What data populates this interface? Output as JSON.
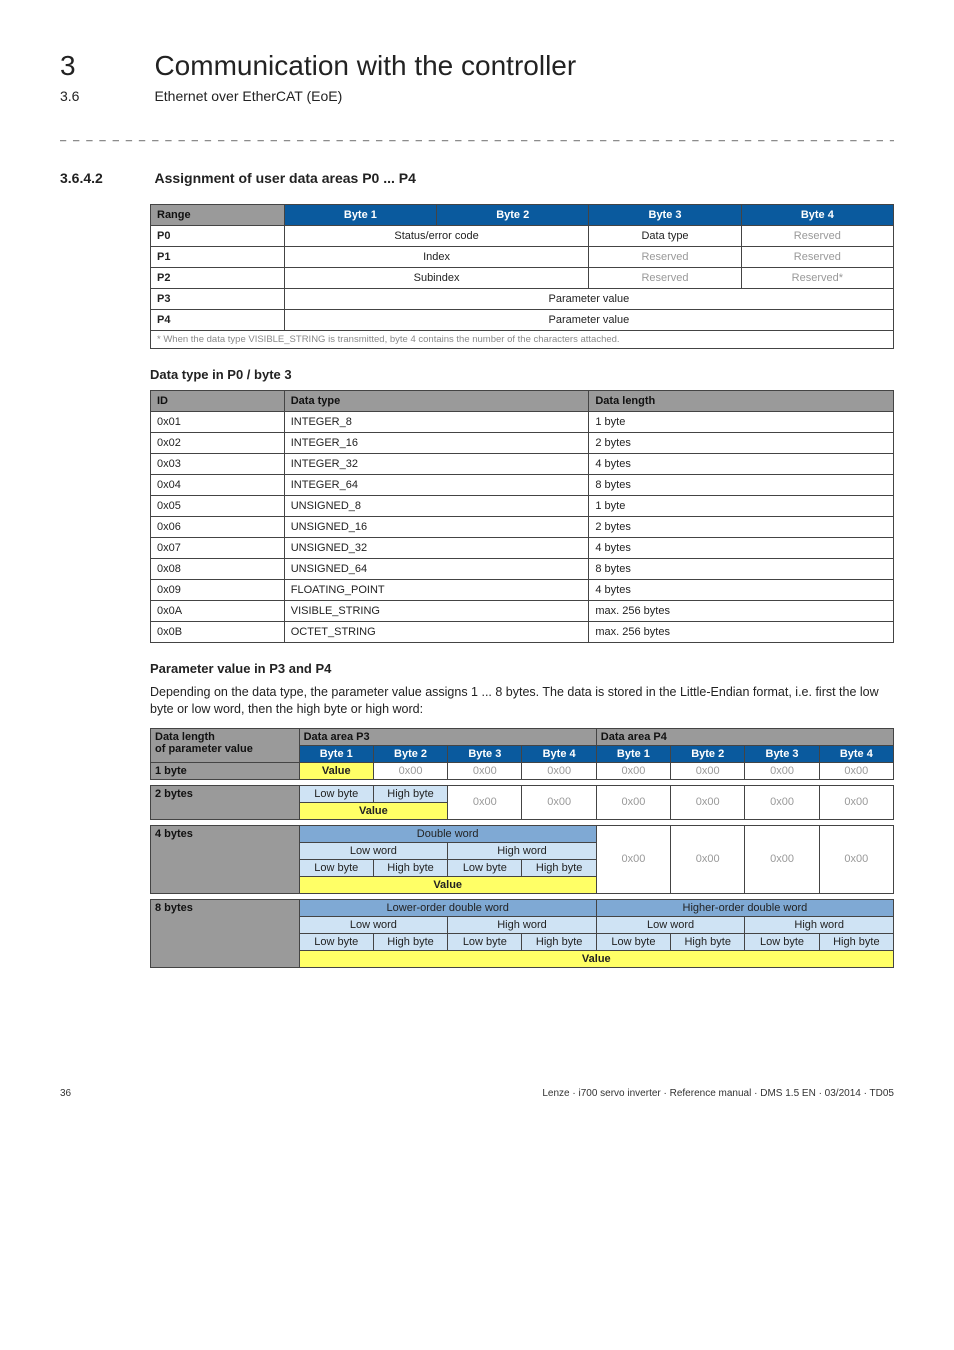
{
  "chapter_num": "3",
  "chapter_title": "Communication with the controller",
  "sect_num": "3.6",
  "sect_title": "Ethernet over EtherCAT (EoE)",
  "subsect_num": "3.6.4.2",
  "subsect_title": "Assignment of user data areas P0 ... P4",
  "tbl1": {
    "head": [
      "Range",
      "Byte 1",
      "Byte 2",
      "Byte 3",
      "Byte 4"
    ],
    "r0": {
      "k": "P0",
      "a": "Status/error code",
      "b": "Data type",
      "c": "Reserved"
    },
    "r1": {
      "k": "P1",
      "a": "Index",
      "b": "Reserved",
      "c": "Reserved"
    },
    "r2": {
      "k": "P2",
      "a": "Subindex",
      "b": "Reserved",
      "c": "Reserved*"
    },
    "r3": {
      "k": "P3",
      "a": "Parameter value"
    },
    "r4": {
      "k": "P4",
      "a": "Parameter value"
    },
    "fn": "* When the data type VISIBLE_STRING is transmitted, byte 4 contains the number of the characters attached."
  },
  "datatype_title": "Data type in P0 / byte 3",
  "tbl2": {
    "head": [
      "ID",
      "Data type",
      "Data length"
    ],
    "rows": [
      [
        "0x01",
        "INTEGER_8",
        "1 byte"
      ],
      [
        "0x02",
        "INTEGER_16",
        "2 bytes"
      ],
      [
        "0x03",
        "INTEGER_32",
        "4 bytes"
      ],
      [
        "0x04",
        "INTEGER_64",
        "8 bytes"
      ],
      [
        "0x05",
        "UNSIGNED_8",
        "1 byte"
      ],
      [
        "0x06",
        "UNSIGNED_16",
        "2 bytes"
      ],
      [
        "0x07",
        "UNSIGNED_32",
        "4 bytes"
      ],
      [
        "0x08",
        "UNSIGNED_64",
        "8 bytes"
      ],
      [
        "0x09",
        "FLOATING_POINT",
        "4 bytes"
      ],
      [
        "0x0A",
        "VISIBLE_STRING",
        "max. 256 bytes"
      ],
      [
        "0x0B",
        "OCTET_STRING",
        "max. 256 bytes"
      ]
    ]
  },
  "pv_title": "Parameter value in P3 and P4",
  "pv_text": "Depending on the data type, the parameter value assigns 1 ... 8 bytes. The data is stored in the Little-Endian format, i.e. first the low byte or low word, then the high byte or high word:",
  "tbl3": {
    "col0_a": "Data length",
    "col0_b": "of parameter value",
    "area_p3": "Data area P3",
    "area_p4": "Data area P4",
    "bytehead": [
      "Byte 1",
      "Byte 2",
      "Byte 3",
      "Byte 4",
      "Byte 1",
      "Byte 2",
      "Byte 3",
      "Byte 4"
    ],
    "r1byte_k": "1 byte",
    "value_lbl": "Value",
    "zero": "0x00",
    "r2byte_k": "2 bytes",
    "lowbyte": "Low byte",
    "highbyte": "High byte",
    "r4byte_k": "4 bytes",
    "doubleword": "Double word",
    "lowword": "Low word",
    "highword": "High word",
    "r8byte_k": "8 bytes",
    "lodw": "Lower-order double word",
    "hodw": "Higher-order double word"
  },
  "page_num": "36",
  "footer_right": "Lenze · i700 servo inverter · Reference manual · DMS 1.5 EN · 03/2014 · TD05"
}
